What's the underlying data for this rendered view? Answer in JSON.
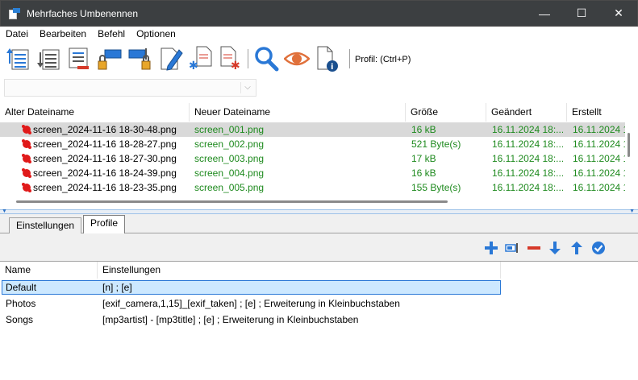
{
  "window": {
    "title": "Mehrfaches Umbenennen",
    "minimize": "—",
    "maximize": "☐",
    "close": "✕"
  },
  "menu": [
    "Datei",
    "Bearbeiten",
    "Befehl",
    "Optionen"
  ],
  "toolbar": {
    "profile_label": "Profil: (Ctrl+P)"
  },
  "filter": {
    "value": ""
  },
  "filelist": {
    "columns": [
      "Alter Dateiname",
      "Neuer Dateiname",
      "Größe",
      "Geändert",
      "Erstellt"
    ],
    "rows": [
      {
        "old": "screen_2024-11-16 18-30-48.png",
        "new": "screen_001.png",
        "size": "16 kB",
        "modified": "16.11.2024 18:...",
        "created": "16.11.2024 1"
      },
      {
        "old": "screen_2024-11-16 18-28-27.png",
        "new": "screen_002.png",
        "size": "521 Byte(s)",
        "modified": "16.11.2024 18:...",
        "created": "16.11.2024 1"
      },
      {
        "old": "screen_2024-11-16 18-27-30.png",
        "new": "screen_003.png",
        "size": "17 kB",
        "modified": "16.11.2024 18:...",
        "created": "16.11.2024 1"
      },
      {
        "old": "screen_2024-11-16 18-24-39.png",
        "new": "screen_004.png",
        "size": "16 kB",
        "modified": "16.11.2024 18:...",
        "created": "16.11.2024 1"
      },
      {
        "old": "screen_2024-11-16 18-23-35.png",
        "new": "screen_005.png",
        "size": "155 Byte(s)",
        "modified": "16.11.2024 18:...",
        "created": "16.11.2024 1"
      }
    ]
  },
  "tabs": [
    "Einstellungen",
    "Profile"
  ],
  "profiles": {
    "columns": [
      "Name",
      "Einstellungen"
    ],
    "rows": [
      {
        "name": "Default",
        "settings": "[n] ; [e]"
      },
      {
        "name": "Photos",
        "settings": "[exif_camera,1,15]_[exif_taken] ; [e] ; Erweiterung in Kleinbuchstaben"
      },
      {
        "name": "Songs",
        "settings": "[mp3artist] - [mp3title] ; [e] ; Erweiterung in Kleinbuchstaben"
      }
    ]
  },
  "colors": {
    "accent": "#2a78d6",
    "new_name": "#1e8a1e",
    "selected_row": "#d9d9d9",
    "profile_selection": "#cce8ff"
  }
}
